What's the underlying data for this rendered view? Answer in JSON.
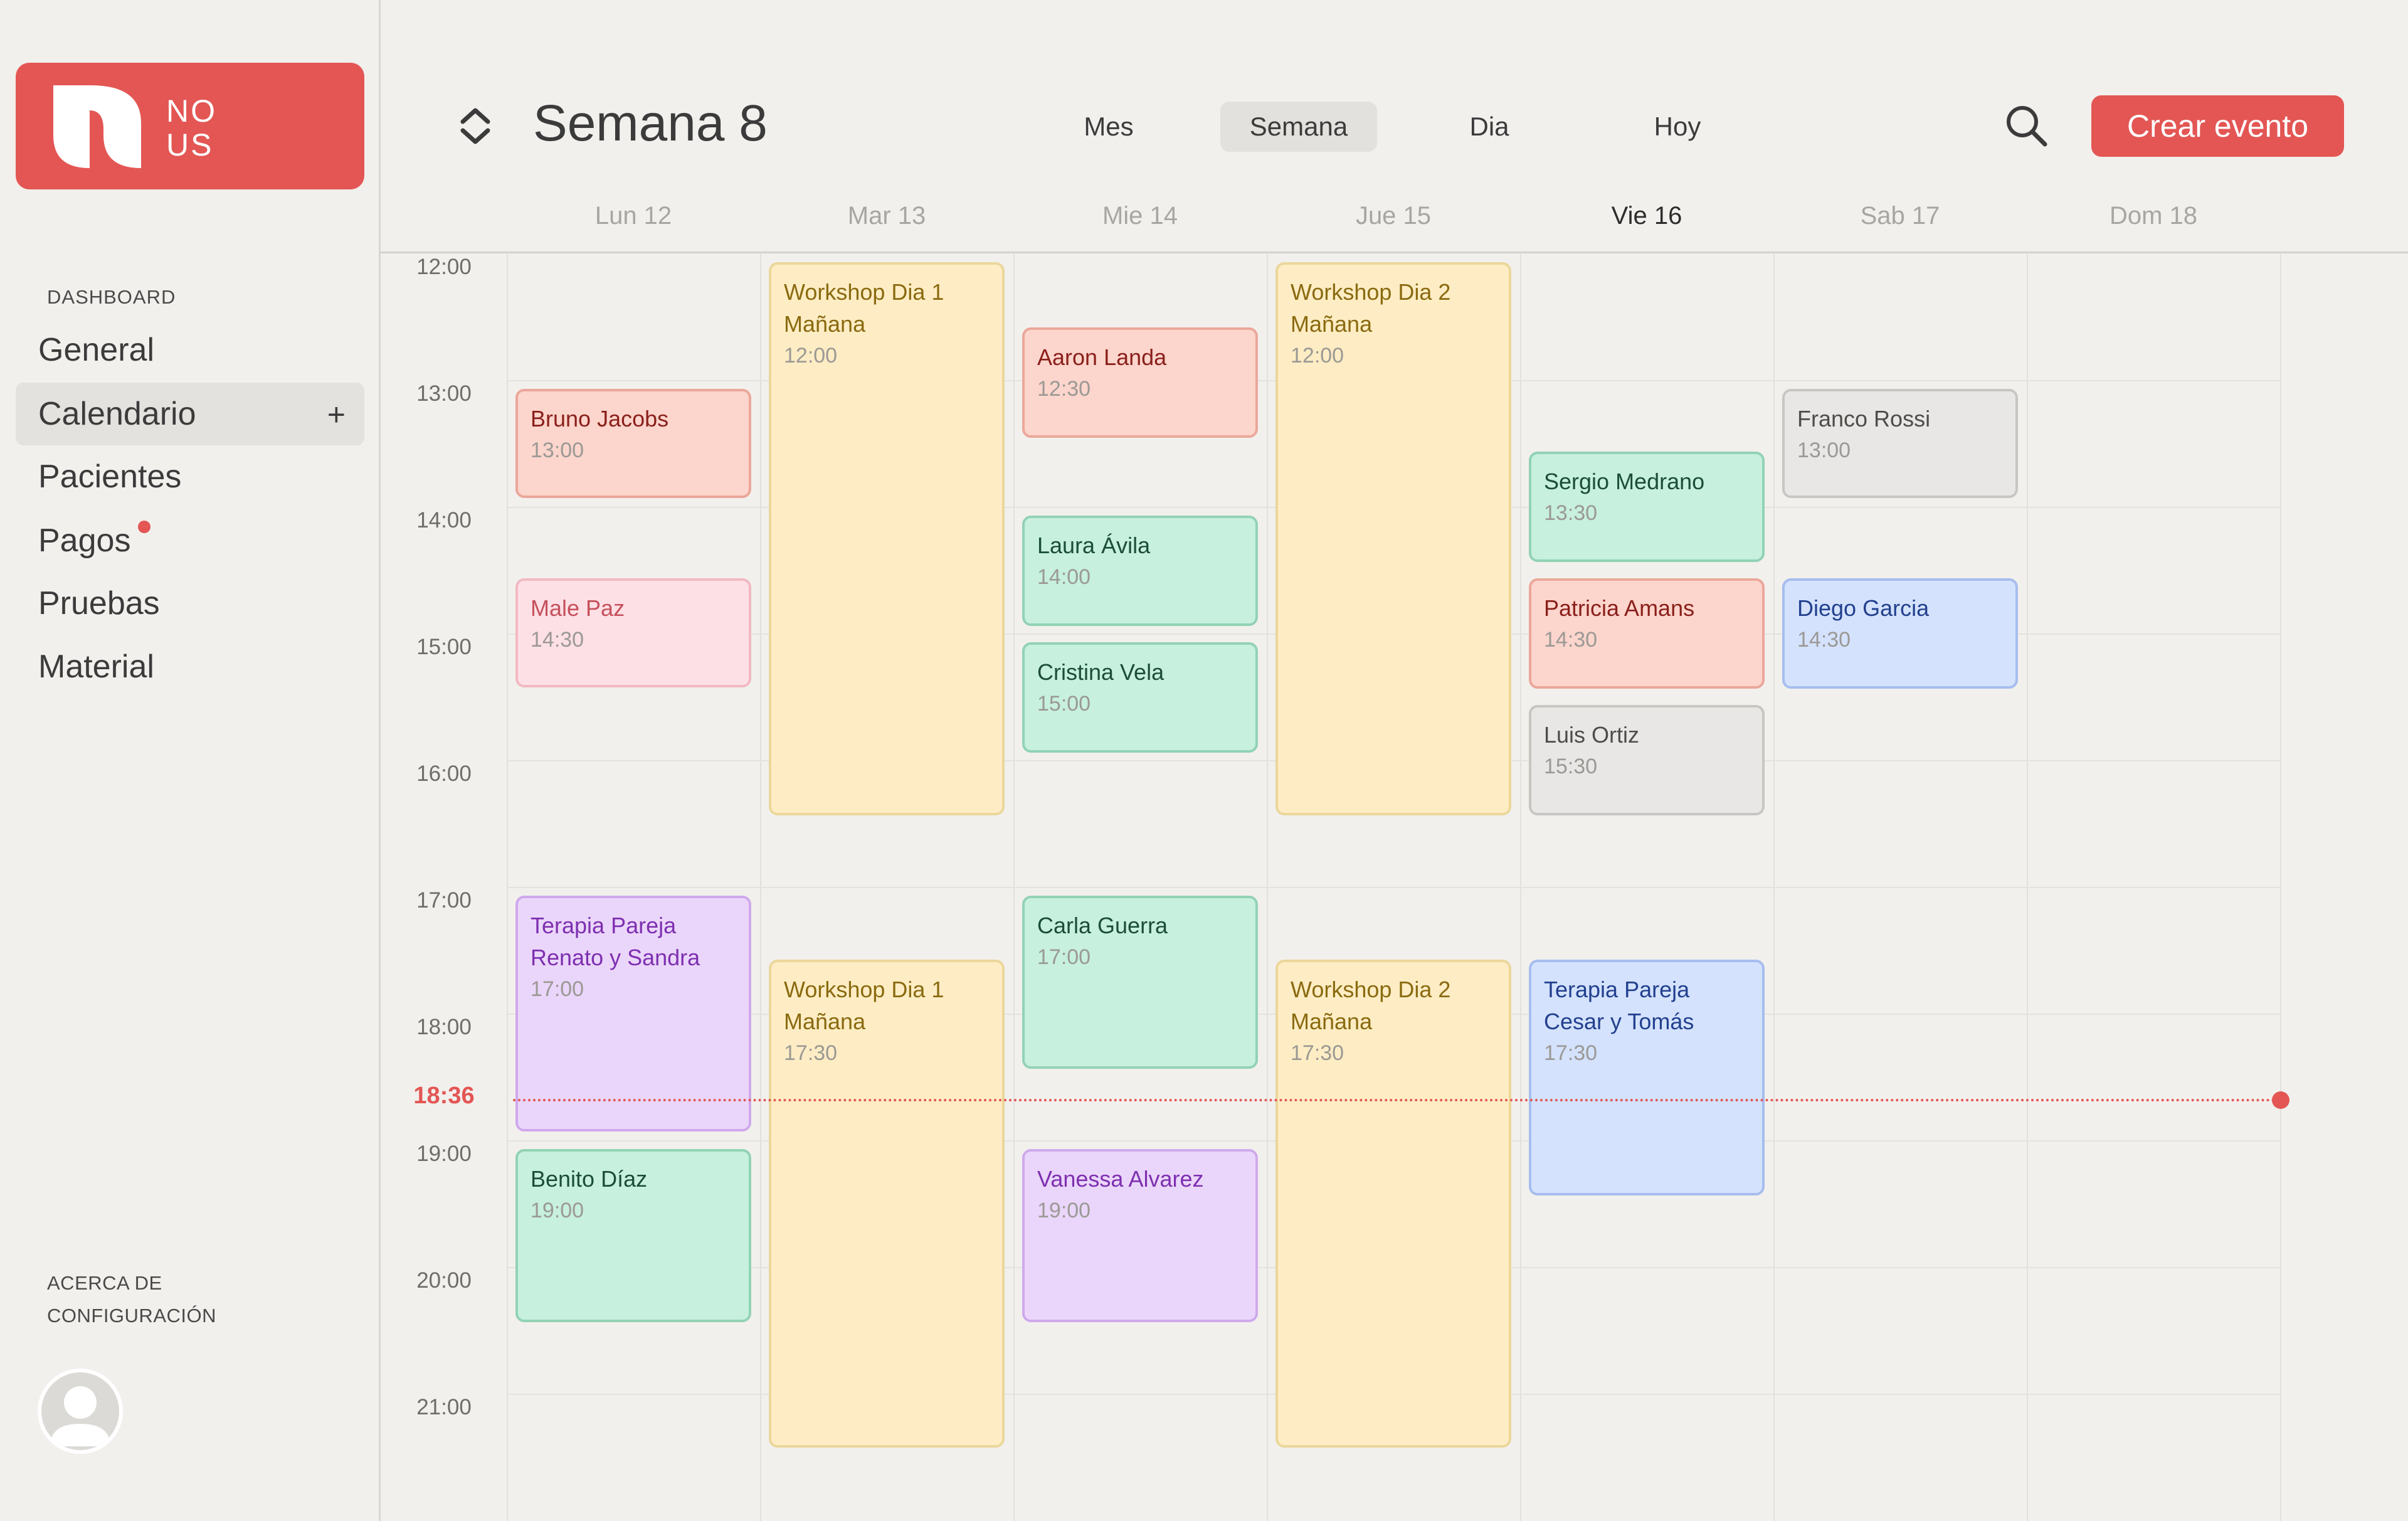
{
  "sidebar": {
    "logo": {
      "line1": "NO",
      "line2": "US"
    },
    "section_label": "DASHBOARD",
    "items": [
      {
        "label": "General"
      },
      {
        "label": "Calendario",
        "action": "+"
      },
      {
        "label": "Pacientes"
      },
      {
        "label": "Pagos"
      },
      {
        "label": "Pruebas"
      },
      {
        "label": "Material"
      }
    ],
    "footer": {
      "about": "ACERCA DE",
      "settings": "CONFIGURACIÓN"
    }
  },
  "header": {
    "title": "Semana 8",
    "views": [
      "Mes",
      "Semana",
      "Dia",
      "Hoy"
    ],
    "active_view": "Semana",
    "create_button": "Crear evento"
  },
  "days": [
    "Lun 12",
    "Mar 13",
    "Mie 14",
    "Jue 15",
    "Vie 16",
    "Sab 17",
    "Dom 18"
  ],
  "today": "Vie 16",
  "hours": [
    "12:00",
    "13:00",
    "14:00",
    "15:00",
    "16:00",
    "17:00",
    "18:00",
    "19:00",
    "20:00",
    "21:00"
  ],
  "now": "18:36",
  "events": [
    {
      "day": 0,
      "title": "Bruno Jacobs",
      "time": "13:00",
      "color": "red"
    },
    {
      "day": 0,
      "title": "Male Paz",
      "time": "14:30",
      "color": "pink"
    },
    {
      "day": 0,
      "title": "Terapia Pareja\nRenato y Sandra",
      "time": "17:00",
      "color": "purple"
    },
    {
      "day": 0,
      "title": "Benito Díaz",
      "time": "19:00",
      "color": "green"
    },
    {
      "day": 1,
      "title": "Workshop Dia 1\nMañana",
      "time": "12:00",
      "color": "yellow"
    },
    {
      "day": 1,
      "title": "Workshop Dia 1\nMañana",
      "time": "17:30",
      "color": "yellow"
    },
    {
      "day": 2,
      "title": "Aaron Landa",
      "time": "12:30",
      "color": "red"
    },
    {
      "day": 2,
      "title": "Laura Ávila",
      "time": "14:00",
      "color": "green"
    },
    {
      "day": 2,
      "title": "Cristina Vela",
      "time": "15:00",
      "color": "green"
    },
    {
      "day": 2,
      "title": "Carla Guerra",
      "time": "17:00",
      "color": "green"
    },
    {
      "day": 2,
      "title": "Vanessa Alvarez",
      "time": "19:00",
      "color": "purple"
    },
    {
      "day": 3,
      "title": "Workshop Dia 2\nMañana",
      "time": "12:00",
      "color": "yellow"
    },
    {
      "day": 3,
      "title": "Workshop Dia 2\nMañana",
      "time": "17:30",
      "color": "yellow"
    },
    {
      "day": 4,
      "title": "Sergio Medrano",
      "time": "13:30",
      "color": "green"
    },
    {
      "day": 4,
      "title": "Patricia Amans",
      "time": "14:30",
      "color": "red"
    },
    {
      "day": 4,
      "title": "Luis Ortiz",
      "time": "15:30",
      "color": "gray"
    },
    {
      "day": 4,
      "title": "Terapia Pareja\nCesar y Tomás",
      "time": "17:30",
      "color": "blue"
    },
    {
      "day": 5,
      "title": "Franco Rossi",
      "time": "13:00",
      "color": "gray"
    },
    {
      "day": 5,
      "title": "Diego Garcia",
      "time": "14:30",
      "color": "blue"
    }
  ],
  "colors": {
    "accent": "#e35654",
    "background": "#f2f0ed"
  }
}
